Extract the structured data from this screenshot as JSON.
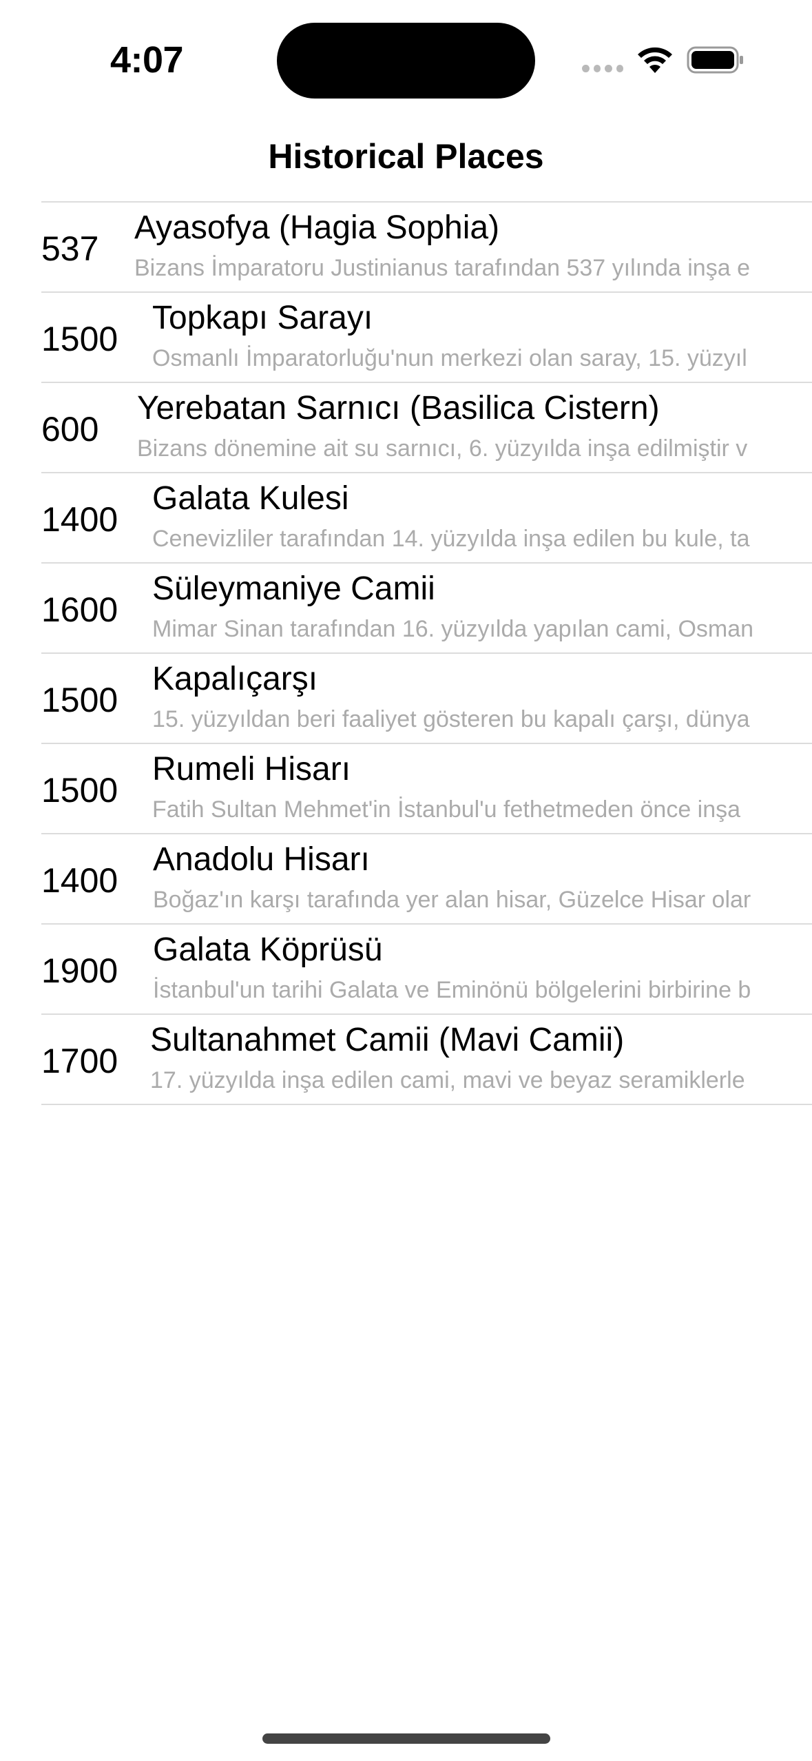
{
  "status_bar": {
    "time": "4:07",
    "wifi_icon": "wifi-icon",
    "battery_icon": "battery-full-icon"
  },
  "nav": {
    "title": "Historical Places"
  },
  "places": [
    {
      "year": "537",
      "title": "Ayasofya (Hagia Sophia)",
      "description": "Bizans İmparatoru Justinianus tarafından 537 yılında inşa e"
    },
    {
      "year": "1500",
      "title": "Topkapı Sarayı",
      "description": "Osmanlı İmparatorluğu'nun merkezi olan saray, 15. yüzyıl"
    },
    {
      "year": "600",
      "title": "Yerebatan Sarnıcı (Basilica Cistern)",
      "description": "Bizans dönemine ait su sarnıcı, 6. yüzyılda inşa edilmiştir v"
    },
    {
      "year": "1400",
      "title": "Galata Kulesi",
      "description": "Cenevizliler tarafından 14. yüzyılda inşa edilen bu kule, ta"
    },
    {
      "year": "1600",
      "title": "Süleymaniye Camii",
      "description": "Mimar Sinan tarafından 16. yüzyılda yapılan cami, Osman"
    },
    {
      "year": "1500",
      "title": "Kapalıçarşı",
      "description": "15. yüzyıldan beri faaliyet gösteren bu kapalı çarşı, dünya"
    },
    {
      "year": "1500",
      "title": "Rumeli Hisarı",
      "description": "Fatih Sultan Mehmet'in İstanbul'u fethetmeden önce inşa"
    },
    {
      "year": "1400",
      "title": "Anadolu Hisarı",
      "description": "Boğaz'ın karşı tarafında yer alan hisar, Güzelce Hisar olar"
    },
    {
      "year": "1900",
      "title": "Galata Köprüsü",
      "description": "İstanbul'un tarihi Galata ve Eminönü bölgelerini birbirine b"
    },
    {
      "year": "1700",
      "title": "Sultanahmet Camii (Mavi Camii)",
      "description": "17. yüzyılda inşa edilen cami, mavi ve beyaz seramiklerle"
    }
  ]
}
